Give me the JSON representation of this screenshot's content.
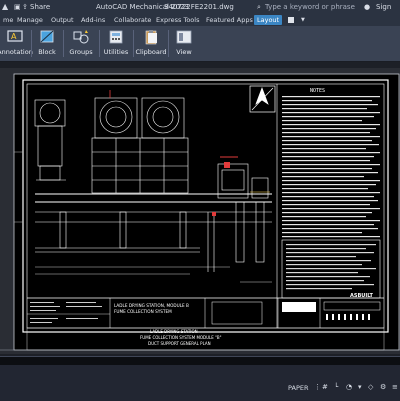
{
  "titlebar": {
    "share_label": "Share",
    "title": "AutoCAD Mechanical 2023",
    "filename": "340722FE2201.dwg",
    "search_placeholder": "Type a keyword or phrase",
    "sign_label": "Sign"
  },
  "ribbon_tabs": [
    "me",
    "Manage",
    "Output",
    "Add-ins",
    "Collaborate",
    "Express Tools",
    "Featured Apps",
    "Layout"
  ],
  "active_tab": "Layout",
  "ribbon": {
    "annotation": "Annotation",
    "block": "Block",
    "groups": "Groups",
    "utilities": "Utilities",
    "clipboard": "Clipboard",
    "view": "View"
  },
  "drawing": {
    "title_line1": "LADLE DRYING STATION, MODULE B",
    "title_line2": "FUME COLLECTION SYSTEM",
    "title_line3": "LADLE DRYING STATION",
    "title_line4": "FUME COLLECTION SYSTEM MODULE \"B\"",
    "title_line5": "DUCT SUPPORT GENERAL PLAN",
    "stamp": "ASBUILT",
    "notes_heading": "NOTES"
  },
  "status": {
    "paper": "PAPER"
  },
  "colors": {
    "ribbon": "#3a4354",
    "titlebar": "#2b3341",
    "active_tab": "#3b86c4",
    "canvas": "#000000"
  }
}
